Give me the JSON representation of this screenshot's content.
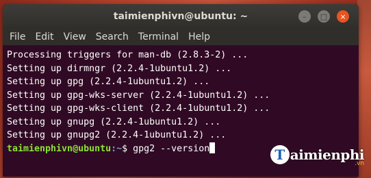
{
  "window": {
    "title": "taimienphivn@ubuntu: ~",
    "buttons": {
      "minimize": "–",
      "maximize": "□",
      "close": "×"
    }
  },
  "menu": [
    "File",
    "Edit",
    "View",
    "Search",
    "Terminal",
    "Help"
  ],
  "terminal": {
    "lines": [
      "Processing triggers for man-db (2.8.3-2) ...",
      "Setting up dirmngr (2.2.4-1ubuntu1.2) ...",
      "Setting up gpg (2.2.4-1ubuntu1.2) ...",
      "Setting up gpg-wks-server (2.2.4-1ubuntu1.2) ...",
      "Setting up gpg-wks-client (2.2.4-1ubuntu1.2) ...",
      "Setting up gnupg (2.2.4-1ubuntu1.2) ...",
      "Setting up gnupg2 (2.2.4-1ubuntu1.2) ..."
    ],
    "prompt": {
      "user": "taimienphivn@ubuntu",
      "path": ":~",
      "symbol": "$ ",
      "command": "gpg2 --version"
    }
  },
  "watermark": {
    "letter": "T",
    "text": "aimienphi",
    "sub": ".vn"
  },
  "colors": {
    "terminal_bg": "#300a24",
    "prompt_user": "#8ae234",
    "prompt_path": "#729fcf",
    "close_button": "#e95420"
  }
}
